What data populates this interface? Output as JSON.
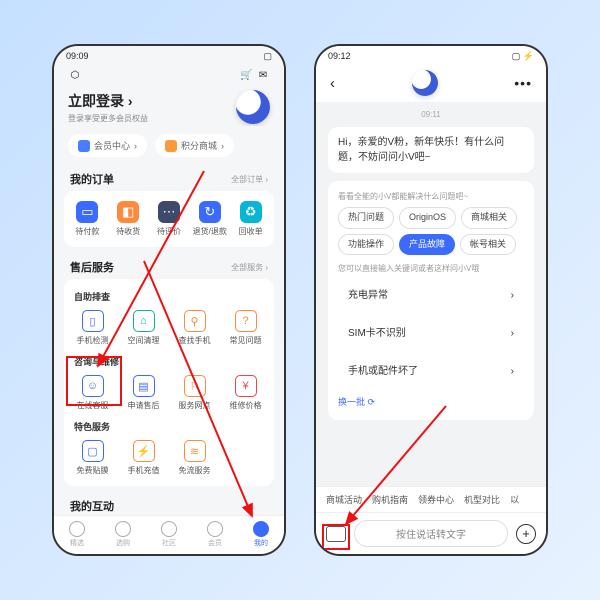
{
  "phone1": {
    "time": "09:09",
    "status_icons": "◎ ✪ ⚙",
    "batt": "▢",
    "login_title": "立即登录",
    "login_sub": "登录享受更多会员权益",
    "pill_member": "会员中心",
    "pill_points": "积分商城",
    "orders": {
      "title": "我的订单",
      "more": "全部订单 ›",
      "items": [
        "待付款",
        "待收货",
        "待评价",
        "退货/退款",
        "回收单"
      ]
    },
    "service": {
      "title": "售后服务",
      "more": "全部服务 ›",
      "g1_title": "自助排查",
      "g1": [
        "手机检测",
        "空间清理",
        "查找手机",
        "常见问题"
      ],
      "g2_title": "咨询与维修",
      "g2": [
        "在线客服",
        "申请售后",
        "服务网点",
        "维修价格"
      ],
      "g3_title": "特色服务",
      "g3": [
        "免费贴膜",
        "手机充值",
        "免流服务"
      ]
    },
    "interact": "我的互动",
    "tabs": [
      "精选",
      "选购",
      "社区",
      "会员",
      "我的"
    ]
  },
  "phone2": {
    "time": "09:12",
    "status_icons": "✪ ⚙ ◎ ⚡",
    "batt": "▢ ⚡",
    "chat_ts": "09:11",
    "greeting": "Hi，亲爱的V粉，新年快乐！有什么问题，不妨问问小V吧~",
    "hint1": "看看全能的小V都能解决什么问题吧~",
    "chips": [
      "热门问题",
      "OriginOS",
      "商城相关",
      "功能操作",
      "产品故障",
      "帐号相关"
    ],
    "chip_active_index": 4,
    "hint2": "您可以直接输入关键词或者这样问小V哦",
    "quick": [
      "充电异常",
      "SIM卡不识别",
      "手机或配件坏了"
    ],
    "refresh": "换一批 ⟳",
    "hchips": [
      "商城活动",
      "购机指南",
      "领券中心",
      "机型对比",
      "以"
    ],
    "input_placeholder": "按住说话转文字"
  }
}
